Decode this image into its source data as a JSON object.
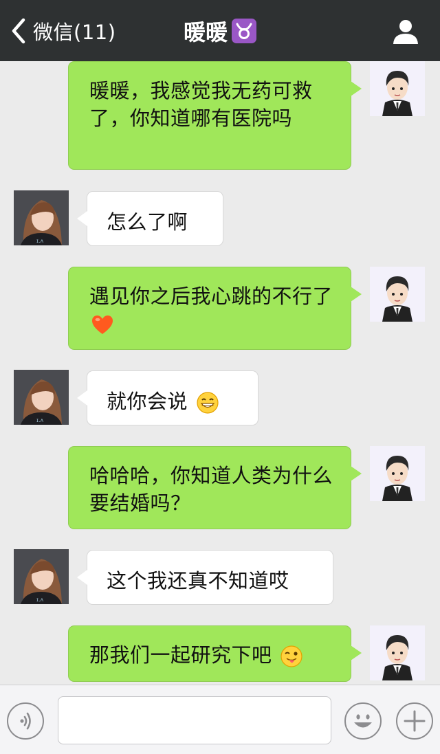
{
  "header": {
    "back_label": "微信(11)",
    "title": "暖暖",
    "title_badge_icon": "taurus-icon"
  },
  "messages": [
    {
      "sender": "me",
      "text": "暖暖，我感觉我无药可救了，你知道哪有医院吗"
    },
    {
      "sender": "her",
      "text": "怎么了啊"
    },
    {
      "sender": "me",
      "text": "遇见你之后我心跳的不行了",
      "emoji": "heart-icon"
    },
    {
      "sender": "her",
      "text": "就你会说",
      "emoji": "grin-emoji-icon"
    },
    {
      "sender": "me",
      "text": "哈哈哈，你知道人类为什么要结婚吗？"
    },
    {
      "sender": "her",
      "text": "这个我还真不知道哎"
    },
    {
      "sender": "me",
      "text": "那我们一起研究下吧",
      "emoji": "wink-tongue-emoji-icon"
    }
  ],
  "input": {
    "value": "",
    "voice_icon": "voice-icon",
    "emoji_icon": "smiley-icon",
    "plus_icon": "plus-icon"
  },
  "colors": {
    "header_bg": "#2e3132",
    "chat_bg": "#ebebeb",
    "my_bubble": "#a0e75a",
    "her_bubble": "#ffffff"
  }
}
